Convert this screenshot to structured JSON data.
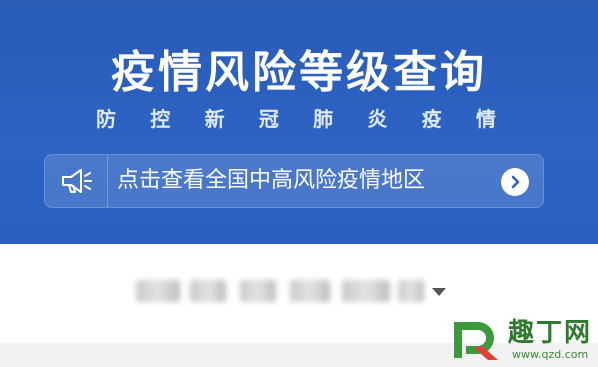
{
  "header": {
    "title": "疫情风险等级查询",
    "subtitle_chars": [
      "防",
      "控",
      "新",
      "冠",
      "肺",
      "炎",
      "疫",
      "情"
    ]
  },
  "notice": {
    "icon": "megaphone-icon",
    "text": "点击查看全国中高风险疫情地区",
    "arrow_icon": "chevron-right-icon"
  },
  "location_selector": {
    "value_obscured": true,
    "caret_icon": "caret-down-icon"
  },
  "watermark": {
    "name": "趣丁网",
    "url": "www.qzd.com",
    "logo_icon": "qzd-logo-icon"
  },
  "colors": {
    "banner": "#2d63c4",
    "notice_bg": "rgba(255,255,255,0.14)",
    "text_primary": "#ffffff",
    "subtitle": "#dfe9ff",
    "watermark_green": "#2f7a2f"
  }
}
